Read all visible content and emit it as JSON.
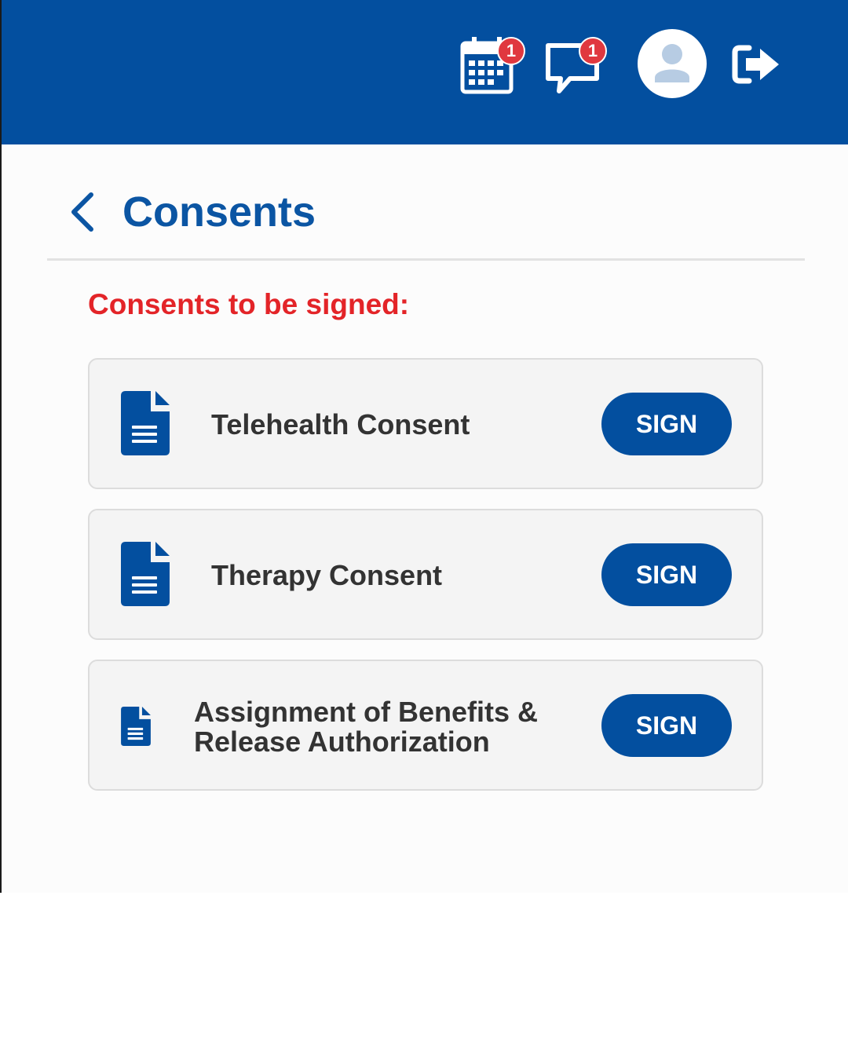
{
  "topbar": {
    "calendar_badge": "1",
    "messages_badge": "1"
  },
  "header": {
    "title": "Consents"
  },
  "section": {
    "title": "Consents to be signed:"
  },
  "consents": [
    {
      "label": "Telehealth Consent",
      "button": "SIGN"
    },
    {
      "label": "Therapy Consent",
      "button": "SIGN"
    },
    {
      "label_line1": "Assignment of Benefits &",
      "label_line2": "Release Authorization",
      "button": "SIGN"
    }
  ],
  "colors": {
    "brand_blue": "#034f9f",
    "alert_red": "#e32428",
    "badge_red": "#e0383f"
  },
  "icons": [
    "calendar-icon",
    "chat-icon",
    "user-avatar-icon",
    "logout-icon",
    "chevron-left-icon",
    "document-icon"
  ]
}
